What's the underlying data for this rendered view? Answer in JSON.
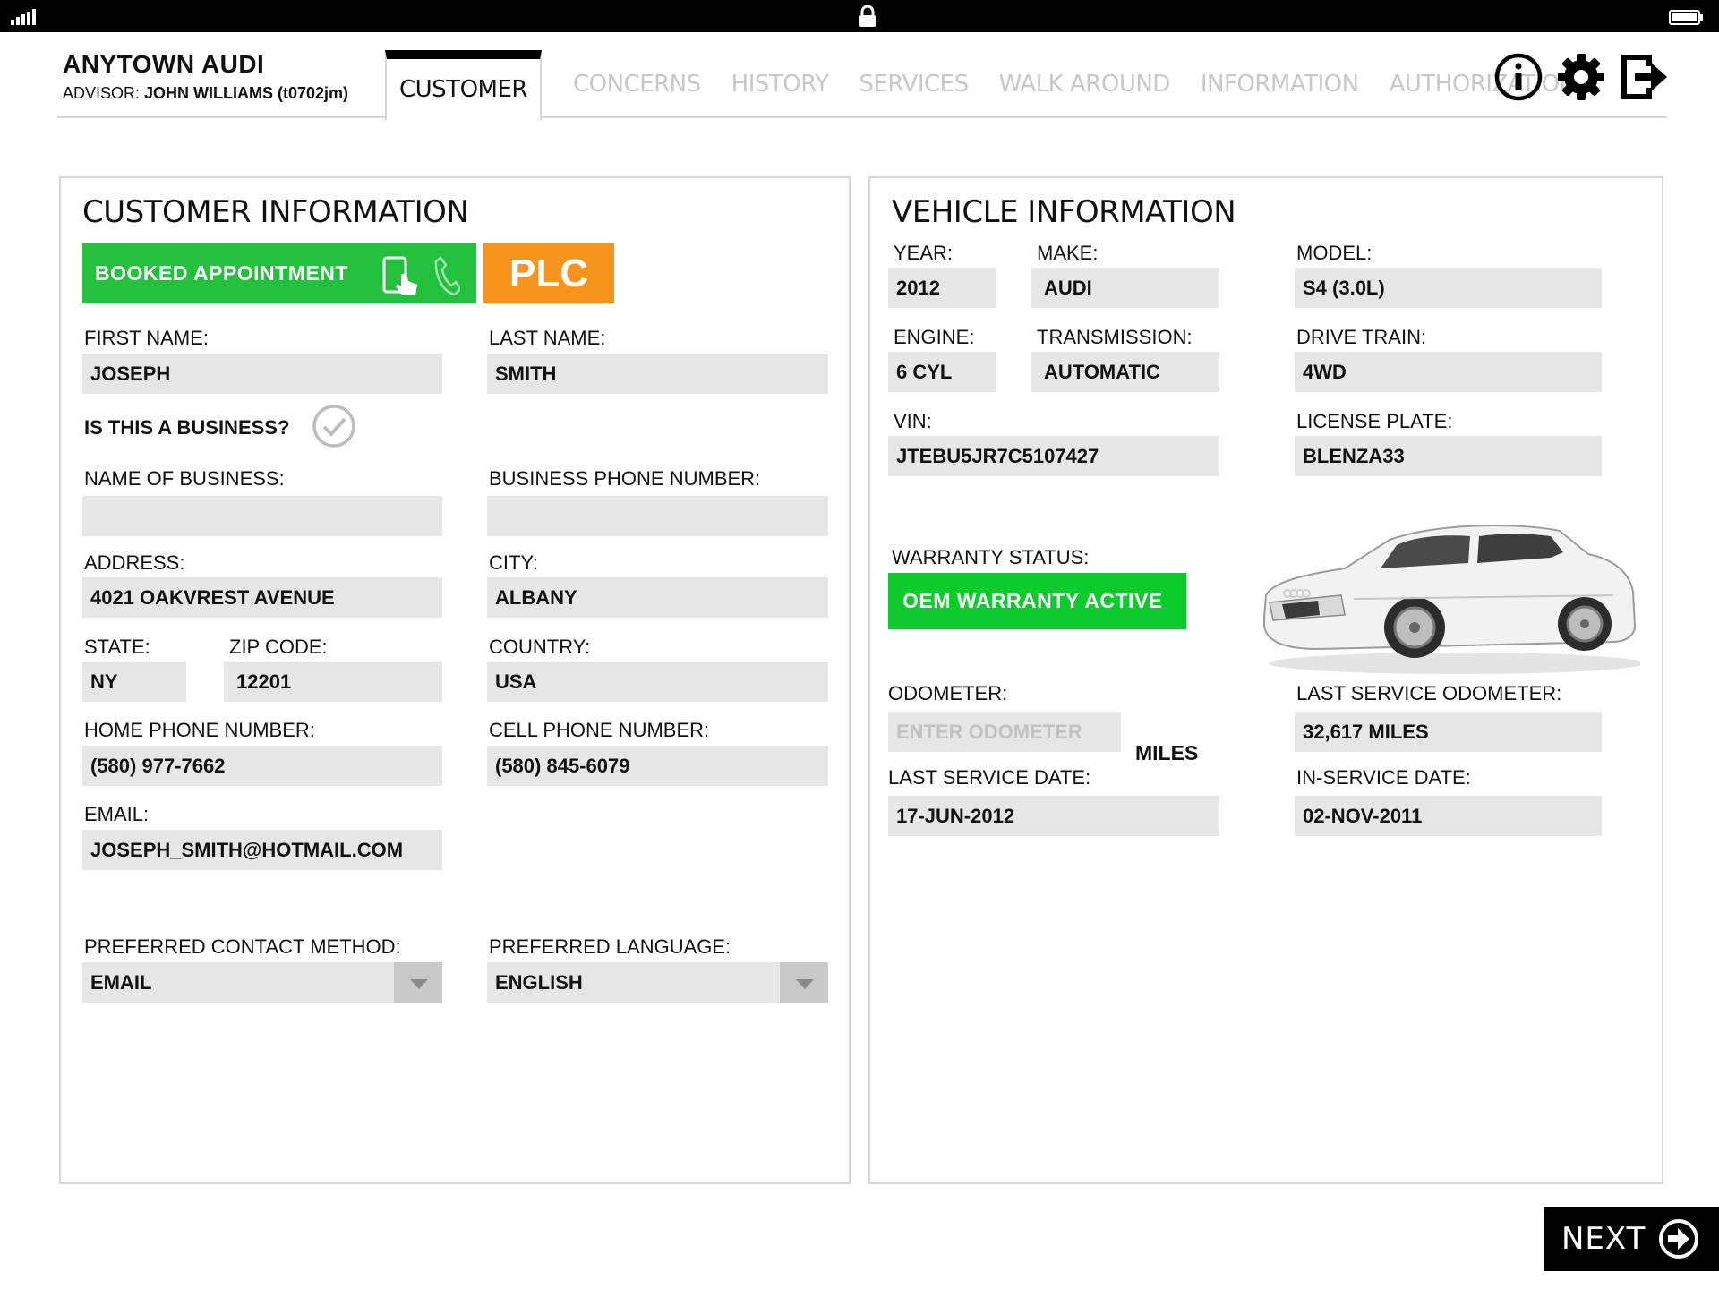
{
  "header": {
    "dealer": "ANYTOWN AUDI",
    "advisor_label": "ADVISOR: ",
    "advisor_name": "JOHN WILLIAMS (t0702jm)"
  },
  "tabs": [
    {
      "label": "CUSTOMER",
      "active": true
    },
    {
      "label": "CONCERNS"
    },
    {
      "label": "HISTORY"
    },
    {
      "label": "SERVICES"
    },
    {
      "label": "WALK AROUND"
    },
    {
      "label": "INFORMATION"
    },
    {
      "label": "AUTHORIZATION"
    }
  ],
  "icons": {
    "info": "info-icon",
    "settings": "gear-icon",
    "logout": "logout-icon"
  },
  "customer": {
    "title": "CUSTOMER INFORMATION",
    "booked_label": "BOOKED APPOINTMENT",
    "plc_label": "PLC",
    "first_name_label": "FIRST NAME:",
    "first_name": "JOSEPH",
    "last_name_label": "LAST NAME:",
    "last_name": "SMITH",
    "business_question": "IS THIS A BUSINESS?",
    "business_name_label": "NAME OF BUSINESS:",
    "business_name": "",
    "business_phone_label": "BUSINESS PHONE NUMBER:",
    "business_phone": "",
    "address_label": "ADDRESS:",
    "address": "4021 OAKVREST AVENUE",
    "city_label": "CITY:",
    "city": "ALBANY",
    "state_label": "STATE:",
    "state": "NY",
    "zip_label": "ZIP CODE:",
    "zip": "12201",
    "country_label": "COUNTRY:",
    "country": "USA",
    "home_phone_label": "HOME PHONE NUMBER:",
    "home_phone": "(580) 977-7662",
    "cell_phone_label": "CELL PHONE NUMBER:",
    "cell_phone": "(580) 845-6079",
    "email_label": "EMAIL:",
    "email": "JOSEPH_SMITH@HOTMAIL.COM",
    "contact_method_label": "PREFERRED CONTACT METHOD:",
    "contact_method": "EMAIL",
    "language_label": "PREFERRED LANGUAGE:",
    "language": "ENGLISH"
  },
  "vehicle": {
    "title": "VEHICLE INFORMATION",
    "year_label": "YEAR:",
    "year": "2012",
    "make_label": "MAKE:",
    "make": "AUDI",
    "model_label": "MODEL:",
    "model": "S4 (3.0L)",
    "engine_label": "ENGINE:",
    "engine": "6 CYL",
    "transmission_label": "TRANSMISSION:",
    "transmission": "AUTOMATIC",
    "drive_train_label": "DRIVE TRAIN:",
    "drive_train": "4WD",
    "vin_label": "VIN:",
    "vin": "JTEBU5JR7C5107427",
    "plate_label": "LICENSE PLATE:",
    "plate": "BLENZA33",
    "warranty_label": "WARRANTY STATUS:",
    "warranty": "OEM WARRANTY ACTIVE",
    "odometer_label": "ODOMETER:",
    "odometer_placeholder": "ENTER ODOMETER",
    "odometer_unit": "MILES",
    "last_service_odometer_label": "LAST SERVICE ODOMETER:",
    "last_service_odometer": "32,617 MILES",
    "last_service_date_label": "LAST SERVICE DATE:",
    "last_service_date": "17-JUN-2012",
    "in_service_date_label": "IN-SERVICE DATE:",
    "in_service_date": "02-NOV-2011"
  },
  "footer": {
    "next_label": "NEXT"
  },
  "colors": {
    "booked": "#23c03d",
    "plc": "#f7941d",
    "warranty": "#0bcc2a",
    "field_bg": "#e6e6e6"
  }
}
